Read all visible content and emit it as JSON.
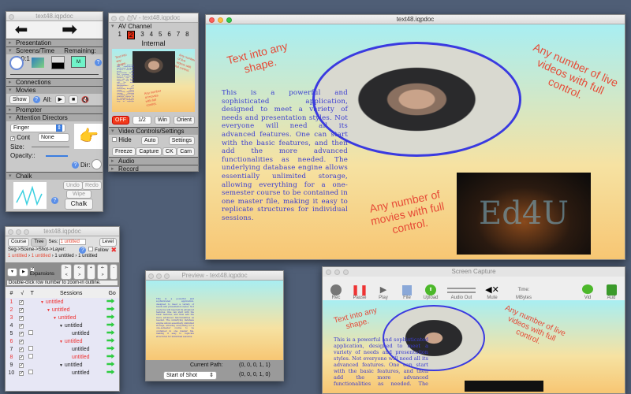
{
  "control_window": {
    "title": "text48.iqpdoc",
    "sections": {
      "presentation": "Presentation",
      "screens_time": "Screens/Time",
      "remaining": "Remaining: 0:0:1",
      "connections": "Connections",
      "movies": "Movies",
      "prompter": "Prompter",
      "attention": "Attention Directors",
      "chalk": "Chalk"
    },
    "movies": {
      "show": "Show",
      "all": "All:"
    },
    "attention": {
      "pointer": "Finger",
      "cont": "Cont",
      "cont_option": "None",
      "size": "Size:",
      "opacity": "Opacity::",
      "dir": "Dir:",
      "size_value": 0.6,
      "opacity_value": 1.0
    },
    "chalk": {
      "undo": "Undo",
      "redo": "Redo",
      "wipe": "Wipe",
      "chalk": "Chalk"
    },
    "screen_icon_label": "M"
  },
  "av_window": {
    "title": "A/V - text48.iqpdoc",
    "av_channel": "AV Channel",
    "channels": [
      "1",
      "2",
      "3",
      "4",
      "5",
      "6",
      "7",
      "8"
    ],
    "selected_channel": "2",
    "internal": "Internal",
    "off": "OFF",
    "scale": "1/2",
    "win": "Win",
    "orient": "Orient",
    "video_controls": "Video Controls/Settings",
    "hide": "Hide",
    "auto": "Auto",
    "settings": "Settings",
    "freeze": "Freeze",
    "capture": "Capture",
    "ck": "CK",
    "cam": "Cam",
    "audio": "Audio",
    "record": "Record"
  },
  "main_window": {
    "title": "text48.iqpdoc",
    "shape_text": "Text into any shape.",
    "live_text": "Any number of live videos with full control.",
    "movies_text": "Any number of movies with full control.",
    "movie_logo": "Ed4U",
    "paragraph": "This is a powerful and sophisticated application, designed to meet a variety of needs and presentation styles. Not everyone will need all its advanced features. One can start with the basic features, and then add the more advanced functionalities as needed. The underlying database engine allows essentially unlimited storage, allowing everything for a one-semester course to be contained in one master file, making it easy to replicate structures for individual sessions."
  },
  "outline_window": {
    "title": "text48.iqpdoc",
    "course": "Course",
    "tree": "Tree",
    "ses_label": "Ses:",
    "ses_value": "1 untitled",
    "level": "Level",
    "path_label": "Seg->Scene->Shot->Layer:",
    "follow": "Follow",
    "breadcrumb": [
      "1 untitled",
      "1 untitled",
      "1 untitled",
      "1 untitled"
    ],
    "expansions": "Expansions",
    "nav_buttons": [
      ">-<",
      "<->",
      "+",
      "+->",
      "-"
    ],
    "hint": "Double-click row number to zoom-in outline.",
    "columns": [
      "#",
      "√",
      "T",
      "Sessions",
      "Go"
    ],
    "rows": [
      {
        "n": "1",
        "label": "untitled",
        "level": 0,
        "red": true,
        "expand": true,
        "t": false
      },
      {
        "n": "2",
        "label": "untitled",
        "level": 1,
        "red": true,
        "expand": true,
        "t": false
      },
      {
        "n": "3",
        "label": "untitled",
        "level": 2,
        "red": true,
        "expand": true,
        "t": false
      },
      {
        "n": "4",
        "label": "untitled",
        "level": 3,
        "red": false,
        "expand": true,
        "t": false
      },
      {
        "n": "5",
        "label": "untitled",
        "level": 4,
        "red": false,
        "expand": false,
        "t": true
      },
      {
        "n": "6",
        "label": "untitled",
        "level": 3,
        "red": true,
        "expand": true,
        "t": false
      },
      {
        "n": "7",
        "label": "untitled",
        "level": 4,
        "red": false,
        "expand": false,
        "t": true
      },
      {
        "n": "8",
        "label": "untitled",
        "level": 4,
        "red": true,
        "expand": false,
        "t": true
      },
      {
        "n": "9",
        "label": "untitled",
        "level": 3,
        "red": false,
        "expand": true,
        "t": false
      },
      {
        "n": "10",
        "label": "untitled",
        "level": 4,
        "red": false,
        "expand": false,
        "t": true
      }
    ]
  },
  "preview_window": {
    "title": "Preview - text48.iqpdoc",
    "current_path_label": "Current Path:",
    "current_path": "(0, 0, 0, 1, 1)",
    "start_option": "Start of Shot",
    "start_path": "(0, 0, 0, 1, 0)"
  },
  "capture_window": {
    "title": "Screen Capture",
    "buttons": [
      "Rec",
      "Pause",
      "Play",
      "File",
      "Upload",
      "Audio Out",
      "Mute",
      "MBytes",
      "Vid",
      "Aud"
    ],
    "time_label": "Time:"
  }
}
